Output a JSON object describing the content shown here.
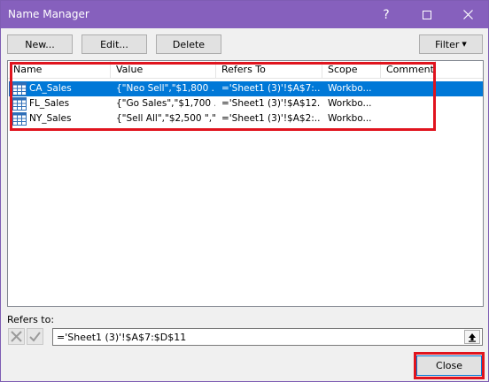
{
  "window": {
    "title": "Name Manager",
    "title_bar_color": "#8660bd"
  },
  "toolbar": {
    "new_label": "New...",
    "edit_label": "Edit...",
    "delete_label": "Delete",
    "filter_label": "Filter"
  },
  "list": {
    "columns": [
      "Name",
      "Value",
      "Refers To",
      "Scope",
      "Comment"
    ],
    "rows": [
      {
        "name": "CA_Sales",
        "value": "{\"Neo Sell\",\"$1,800 ...",
        "refers": "='Sheet1 (3)'!$A$7:...",
        "scope": "Workbo...",
        "comment": "",
        "selected": true
      },
      {
        "name": "FL_Sales",
        "value": "{\"Go Sales\",\"$1,700 ...",
        "refers": "='Sheet1 (3)'!$A$12...",
        "scope": "Workbo...",
        "comment": "",
        "selected": false
      },
      {
        "name": "NY_Sales",
        "value": "{\"Sell All\",\"$2,500 \",\"...",
        "refers": "='Sheet1 (3)'!$A$2:...",
        "scope": "Workbo...",
        "comment": "",
        "selected": false
      }
    ]
  },
  "refers_to": {
    "label": "Refers to:",
    "value": "='Sheet1 (3)'!$A$7:$D$11"
  },
  "footer": {
    "close_label": "Close"
  },
  "colors": {
    "selection": "#0078d7",
    "highlight_box": "#e0141e"
  }
}
